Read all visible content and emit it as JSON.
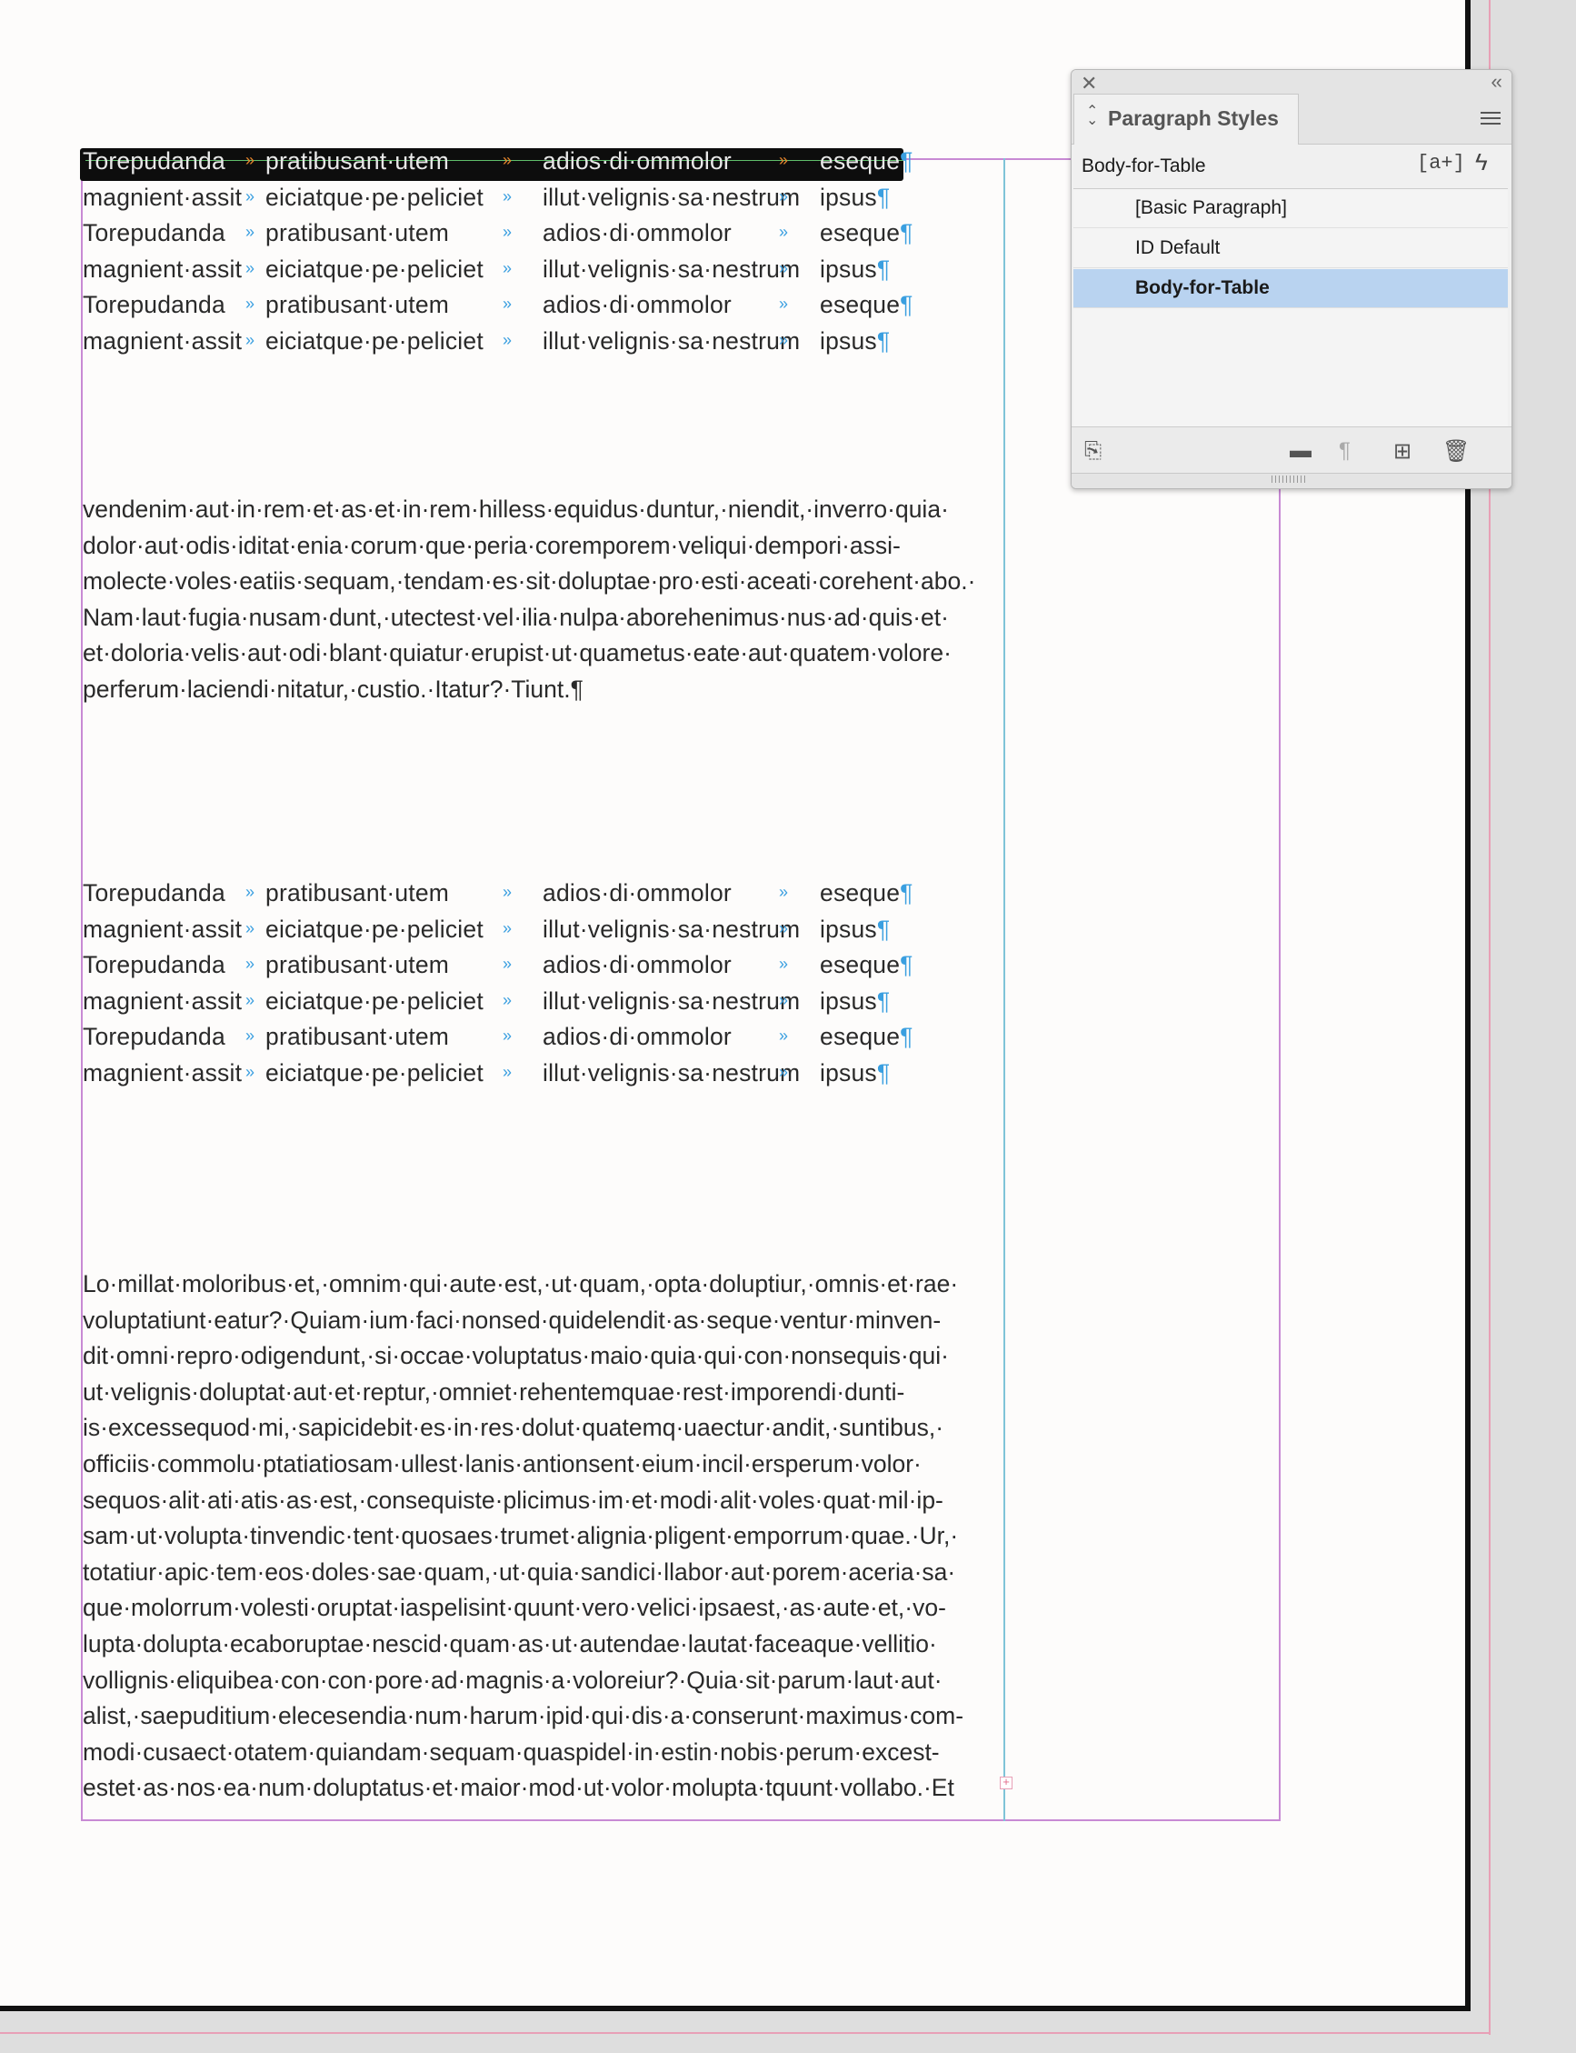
{
  "panel": {
    "tab_label": "Paragraph Styles",
    "current_style": "Body-for-Table",
    "new_override_label": "[a+]",
    "quick_apply_label": "ϟ",
    "items": [
      {
        "label": "[Basic Paragraph]",
        "selected": false
      },
      {
        "label": "ID Default",
        "selected": false
      },
      {
        "label": "Body-for-Table",
        "selected": true
      }
    ]
  },
  "table_block": {
    "row_a": [
      "Torepudanda",
      "pratibusant·utem",
      "adios·di·ommolor",
      "eseque"
    ],
    "row_b": [
      "magnient·assit",
      "eiciatque·pe·peliciet",
      "illut·velignis·sa·nestrum",
      "ipsus"
    ]
  },
  "paragraph1": [
    "vendenim·aut·in·rem·et·as·et·in·rem·hilless·equidus·duntur,·niendit,·inverro·quia·",
    "dolor·aut·odis·iditat·enia·corum·que·peria·coremporem·veliqui·dempori·assi-",
    "molecte·voles·eatiis·sequam,·tendam·es·sit·doluptae·pro·esti·aceati·corehent·abo.·",
    "Nam·laut·fugia·nusam·dunt,·utectest·vel·ilia·nulpa·aborehenimus·nus·ad·quis·et·",
    "et·doloria·velis·aut·odi·blant·quiatur·erupist·ut·quametus·eate·aut·quatem·volore·",
    "perferum·laciendi·nitatur,·custio.·Itatur?·Tiunt.¶"
  ],
  "paragraph2": [
    "Lo·millat·moloribus·et,·omnim·qui·aute·est,·ut·quam,·opta·doluptiur,·omnis·et·rae·",
    "voluptatiunt·eatur?·Quiam·ium·faci·nonsed·quidelendit·as·seque·ventur·minven-",
    "dit·omni·repro·odigendunt,·si·occae·voluptatus·maio·quia·qui·con·nonsequis·qui·",
    "ut·velignis·doluptat·aut·et·reptur,·omniet·rehentemquae·rest·imporendi·dunti-",
    "is·excessequod·mi,·sapicidebit·es·in·res·dolut·quatemq·uaectur·andit,·suntibus,·",
    "officiis·commolu·ptatiatiosam·ullest·lanis·antionsent·eium·incil·ersperum·volor·",
    "sequos·alit·ati·atis·as·est,·consequiste·plicimus·im·et·modi·alit·voles·quat·mil·ip-",
    "sam·ut·volupta·tinvendic·tent·quosaes·trumet·alignia·pligent·emporrum·quae.·Ur,·",
    "totatiur·apic·tem·eos·doles·sae·quam,·ut·quia·sandici·llabor·aut·porem·aceria·sa·",
    "que·molorrum·volesti·oruptat·iaspelisint·quunt·vero·velici·ipsaest,·as·aute·et,·vo-",
    "lupta·dolupta·ecaboruptae·nescid·quam·as·ut·autendae·lautat·faceaque·vellitio·",
    "vollignis·eliquibea·con·con·pore·ad·magnis·a·voloreiur?·Quia·sit·parum·laut·aut·",
    "alist,·saepuditium·elecesendia·num·harum·ipid·qui·dis·a·conserunt·maximus·com-",
    "modi·cusaect·otatem·quiandam·sequam·quaspidel·in·estin·nobis·perum·excest-",
    "estet·as·nos·ea·num·doluptatus·et·maior·mod·ut·volor·molupta·tquunt·vollabo.·Et"
  ],
  "glyphs": {
    "tab": "»",
    "pilcrow": "¶",
    "overflow": "+"
  }
}
